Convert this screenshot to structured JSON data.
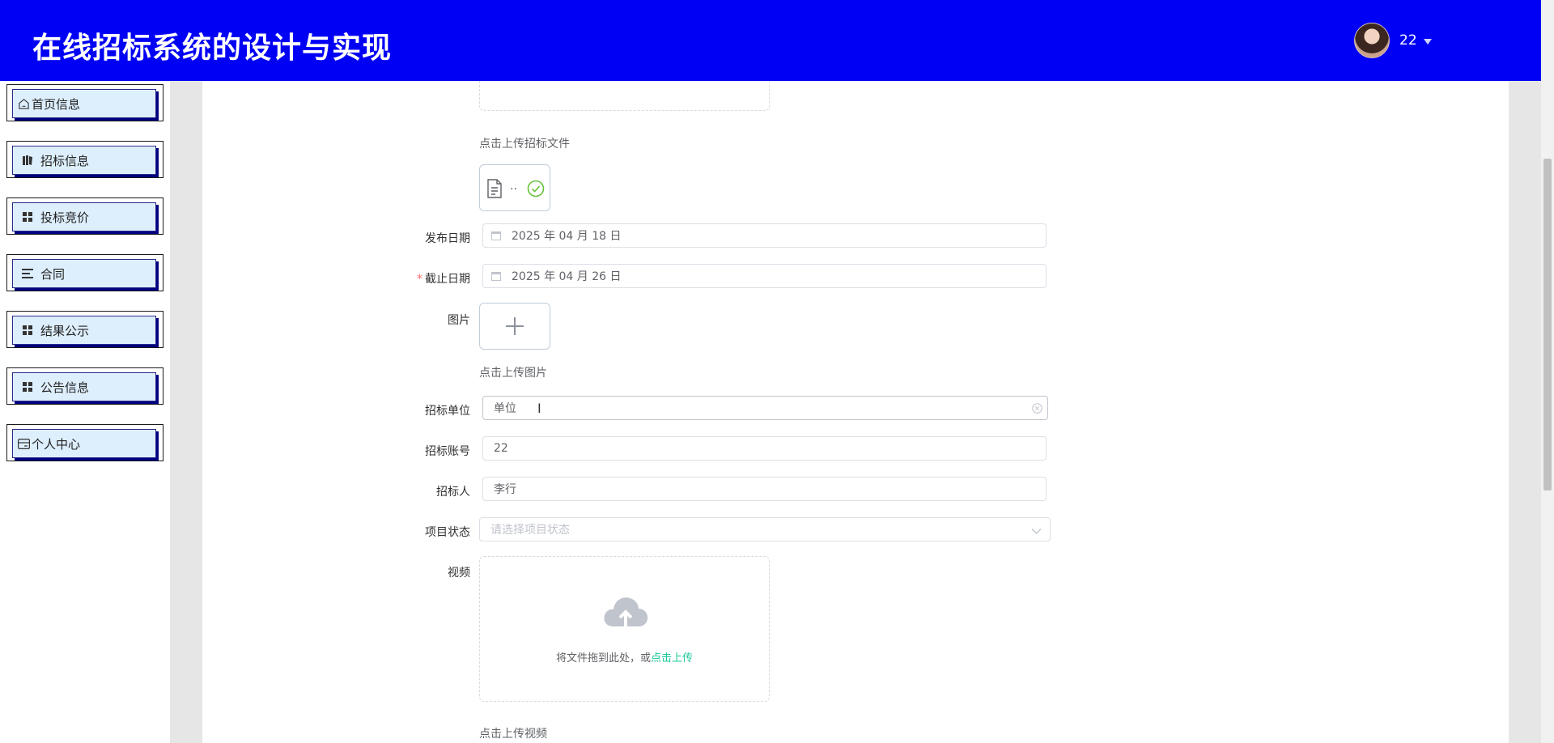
{
  "header": {
    "title": "在线招标系统的设计与实现",
    "user": "22"
  },
  "sidebar": {
    "items": [
      {
        "label": "首页信息",
        "icon": "home-icon"
      },
      {
        "label": "招标信息",
        "icon": "book-icon"
      },
      {
        "label": "投标竞价",
        "icon": "grid-icon"
      },
      {
        "label": "合同",
        "icon": "list-icon"
      },
      {
        "label": "结果公示",
        "icon": "grid-icon"
      },
      {
        "label": "公告信息",
        "icon": "grid-icon"
      },
      {
        "label": "个人中心",
        "icon": "card-icon"
      }
    ]
  },
  "form": {
    "file_hint": "点击上传招标文件",
    "file_name": "..",
    "publish_date": {
      "label": "发布日期",
      "value": "2025 年 04 月 18 日"
    },
    "deadline": {
      "label": "截止日期",
      "required": "*",
      "value": "2025 年 04 月 26 日"
    },
    "image": {
      "label": "图片",
      "hint": "点击上传图片"
    },
    "unit": {
      "label": "招标单位",
      "value": "单位"
    },
    "account": {
      "label": "招标账号",
      "value": "22"
    },
    "person": {
      "label": "招标人",
      "value": "李行"
    },
    "status": {
      "label": "项目状态",
      "placeholder": "请选择项目状态"
    },
    "video": {
      "label": "视频",
      "drop_text": "将文件拖到此处，或",
      "drop_link": "点击上传",
      "hint": "点击上传视频"
    }
  },
  "colors": {
    "header_bg": "#0000f5",
    "link": "#1ec79b",
    "success": "#67c23a",
    "required": "#f56c6c"
  }
}
